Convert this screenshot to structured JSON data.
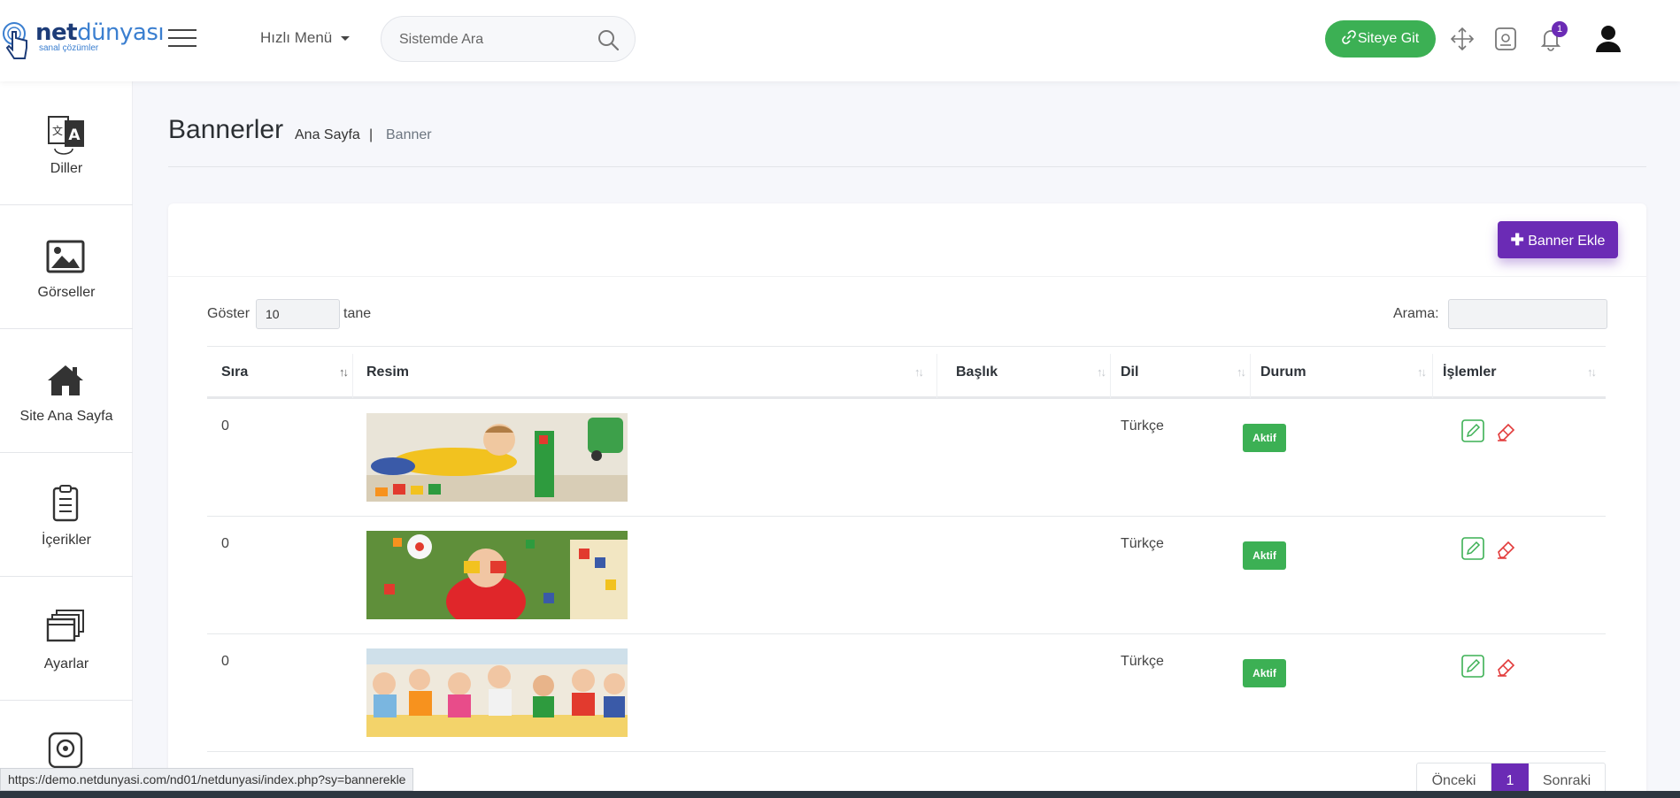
{
  "header": {
    "logo_bold": "net",
    "logo_light": "dünyası",
    "logo_tagline": "sanal çözümler",
    "quick_menu_label": "Hızlı Menü",
    "search_placeholder": "Sistemde Ara",
    "site_button_label": "Siteye Git",
    "notification_count": "1",
    "accent_green": "#3cb054",
    "accent_purple": "#6b2bb5"
  },
  "sidebar": {
    "items": [
      {
        "label": "Diller",
        "icon": "language-icon"
      },
      {
        "label": "Görseller",
        "icon": "image-icon"
      },
      {
        "label": "Site Ana Sayfa",
        "icon": "home-icon"
      },
      {
        "label": "İçerikler",
        "icon": "clipboard-icon"
      },
      {
        "label": "Ayarlar",
        "icon": "windows-icon"
      },
      {
        "label": "",
        "icon": "speaker-icon"
      }
    ]
  },
  "page": {
    "title": "Bannerler",
    "breadcrumb_home": "Ana Sayfa",
    "breadcrumb_separator": "|",
    "breadcrumb_current": "Banner",
    "add_button_label": "Banner Ekle"
  },
  "table_controls": {
    "show_label": "Göster",
    "show_value": "10",
    "show_suffix": "tane",
    "search_label": "Arama:"
  },
  "table": {
    "columns": [
      "Sıra",
      "Resim",
      "Başlık",
      "Dil",
      "Durum",
      "İşlemler"
    ],
    "rows": [
      {
        "order": "0",
        "image": "child-with-building-blocks",
        "title": "",
        "language": "Türkçe",
        "status": "Aktif"
      },
      {
        "order": "0",
        "image": "child-lying-on-grass-with-toys",
        "title": "",
        "language": "Türkçe",
        "status": "Aktif"
      },
      {
        "order": "0",
        "image": "children-crafting-at-table",
        "title": "",
        "language": "Türkçe",
        "status": "Aktif"
      }
    ]
  },
  "pagination": {
    "prev_label": "Önceki",
    "current_page": "1",
    "next_label": "Sonraki"
  },
  "status_bar": {
    "url": "https://demo.netdunyasi.com/nd01/netdunyasi/index.php?sy=bannerekle"
  }
}
